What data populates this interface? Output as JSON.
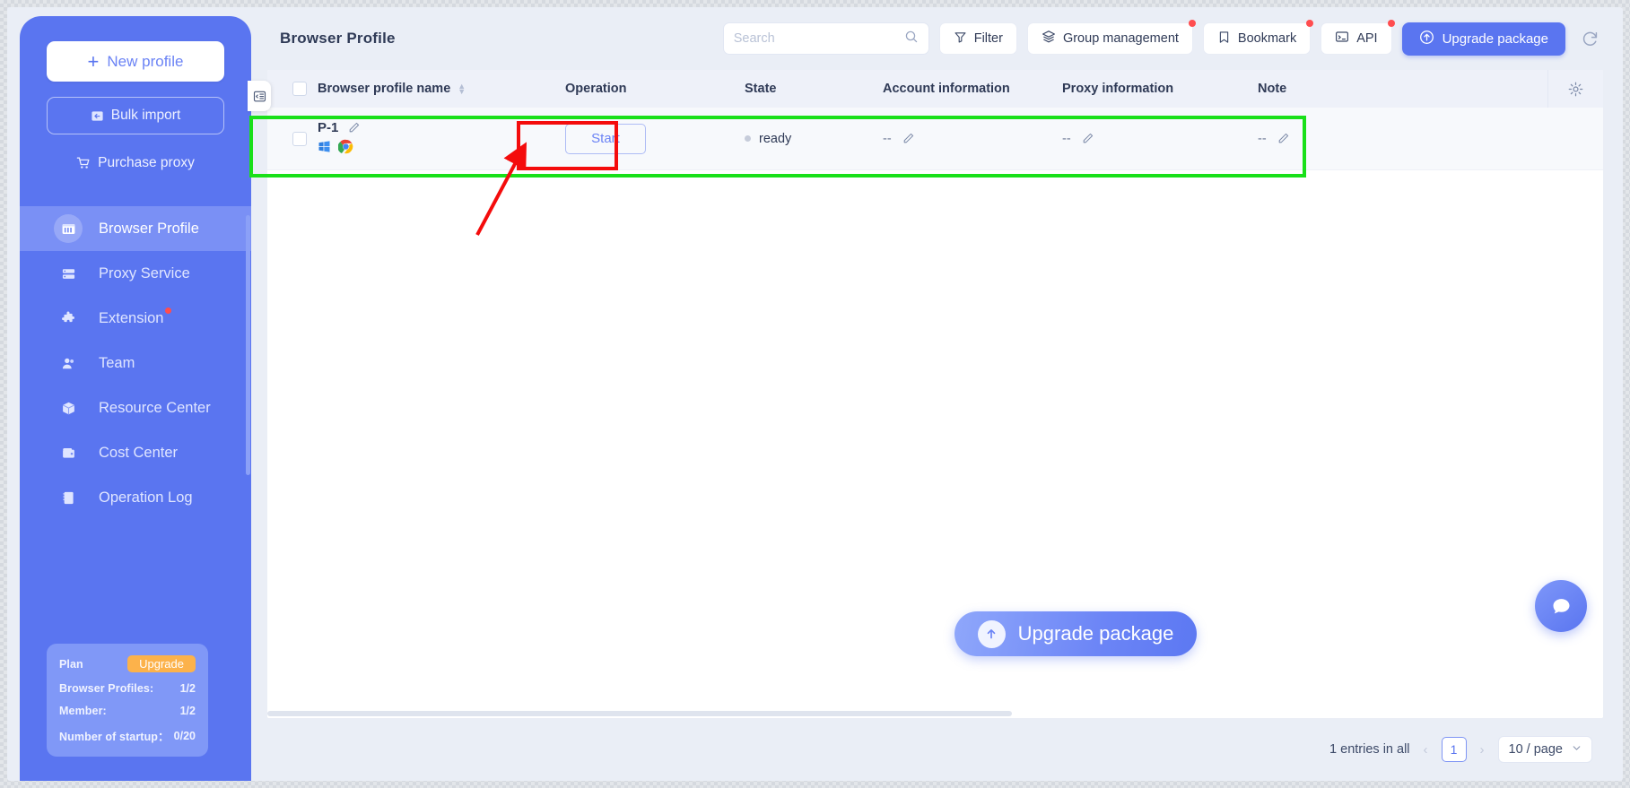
{
  "sidebar": {
    "new_profile": "New profile",
    "bulk_import": "Bulk import",
    "purchase_proxy": "Purchase proxy",
    "items": [
      {
        "label": "Browser Profile",
        "icon": "browser-icon",
        "active": true,
        "badge": false
      },
      {
        "label": "Proxy Service",
        "icon": "server-icon",
        "active": false,
        "badge": false
      },
      {
        "label": "Extension",
        "icon": "puzzle-icon",
        "active": false,
        "badge": true
      },
      {
        "label": "Team",
        "icon": "users-icon",
        "active": false,
        "badge": false
      },
      {
        "label": "Resource Center",
        "icon": "box-icon",
        "active": false,
        "badge": false
      },
      {
        "label": "Cost Center",
        "icon": "wallet-icon",
        "active": false,
        "badge": false
      },
      {
        "label": "Operation Log",
        "icon": "book-icon",
        "active": false,
        "badge": false
      }
    ],
    "plan": {
      "title": "Plan",
      "upgrade_label": "Upgrade",
      "rows": [
        {
          "key": "Browser Profiles:",
          "value": "1/2"
        },
        {
          "key": "Member:",
          "value": "1/2"
        },
        {
          "key": "Number of startup：",
          "value": "0/20"
        }
      ]
    }
  },
  "header": {
    "title": "Browser Profile",
    "search_placeholder": "Search",
    "search_value": "",
    "buttons": [
      {
        "label": "Filter",
        "icon": "filter-icon",
        "badge": false
      },
      {
        "label": "Group management",
        "icon": "layers-icon",
        "badge": true
      },
      {
        "label": "Bookmark",
        "icon": "bookmark-icon",
        "badge": true
      },
      {
        "label": "API",
        "icon": "terminal-icon",
        "badge": true
      }
    ],
    "upgrade_package": "Upgrade package",
    "refresh_icon": "refresh-icon"
  },
  "table": {
    "columns": [
      "Browser profile name",
      "Operation",
      "State",
      "Account information",
      "Proxy information",
      "Note"
    ],
    "settings_icon": "gear-icon",
    "rows": [
      {
        "name": "P-1",
        "os_icon": "windows-icon",
        "browser_icon": "chrome-icon",
        "operation": "Start",
        "state": "ready",
        "account": "--",
        "proxy": "--",
        "note": "--"
      }
    ]
  },
  "cta": {
    "upgrade_package": "Upgrade package",
    "icon": "arrow-up-icon"
  },
  "chat": {
    "icon": "chat-icon"
  },
  "footer": {
    "entries_text": "1 entries in all",
    "prev": "‹",
    "page": "1",
    "next": "›",
    "page_size": "10 / page"
  },
  "colors": {
    "brand": "#5a75f0",
    "sidebar": "#5a75f0",
    "accent_orange": "#fcb24b",
    "badge_red": "#ff4d4f",
    "highlight_green": "#19e019",
    "highlight_red": "#f40c0c"
  }
}
